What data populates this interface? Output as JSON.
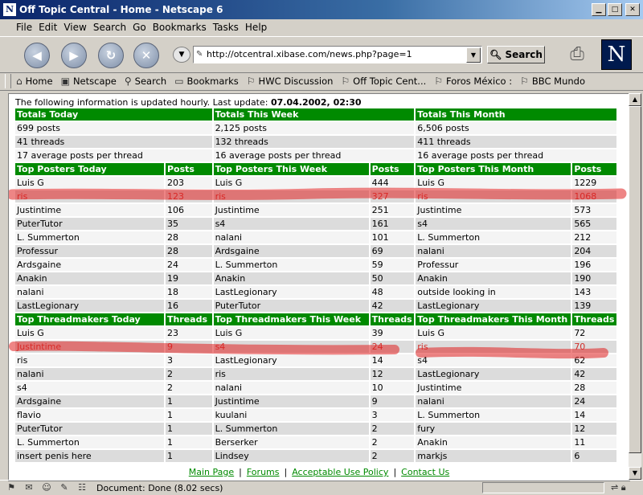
{
  "window": {
    "title": "Off Topic Central - Home - Netscape 6",
    "app_icon": "N"
  },
  "menu": [
    "File",
    "Edit",
    "View",
    "Search",
    "Go",
    "Bookmarks",
    "Tasks",
    "Help"
  ],
  "navigation": {
    "url": "http://otcentral.xibase.com/news.php?page=1",
    "search_label": "Search",
    "logo_letter": "N"
  },
  "personal_toolbar": [
    "Home",
    "Netscape",
    "Search",
    "Bookmarks",
    "HWC Discussion",
    "Off Topic Cent...",
    "Foros México :",
    "BBC Mundo"
  ],
  "update_info": {
    "text": "The following information is updated hourly. Last update: ",
    "date": "07.04.2002, 02:30"
  },
  "totals": {
    "headers": [
      "Totals Today",
      "Totals This Week",
      "Totals This Month"
    ],
    "rows": [
      [
        "699 posts",
        "2,125 posts",
        "6,506 posts"
      ],
      [
        "41 threads",
        "132 threads",
        "411 threads"
      ],
      [
        "17 average posts per thread",
        "16 average posts per thread",
        "16 average posts per thread"
      ]
    ]
  },
  "top_posters": {
    "headers": [
      "Top Posters Today",
      "Posts",
      "Top Posters This Week",
      "Posts",
      "Top Posters This Month",
      "Posts"
    ],
    "rows": [
      [
        "Luis G",
        "203",
        "Luis G",
        "444",
        "Luis G",
        "1229"
      ],
      [
        "ris",
        "123",
        "ris",
        "327",
        "ris",
        "1068"
      ],
      [
        "Justintime",
        "106",
        "Justintime",
        "251",
        "Justintime",
        "573"
      ],
      [
        "PuterTutor",
        "35",
        "s4",
        "161",
        "s4",
        "565"
      ],
      [
        "L. Summerton",
        "28",
        "nalani",
        "101",
        "L. Summerton",
        "212"
      ],
      [
        "Professur",
        "28",
        "Ardsgaine",
        "69",
        "nalani",
        "204"
      ],
      [
        "Ardsgaine",
        "24",
        "L. Summerton",
        "59",
        "Professur",
        "196"
      ],
      [
        "Anakin",
        "19",
        "Anakin",
        "50",
        "Anakin",
        "190"
      ],
      [
        "nalani",
        "18",
        "LastLegionary",
        "48",
        "outside looking in",
        "143"
      ],
      [
        "LastLegionary",
        "16",
        "PuterTutor",
        "42",
        "LastLegionary",
        "139"
      ]
    ]
  },
  "top_threadmakers": {
    "headers": [
      "Top Threadmakers Today",
      "Threads",
      "Top Threadmakers This Week",
      "Threads",
      "Top Threadmakers This Month",
      "Threads"
    ],
    "rows": [
      [
        "Luis G",
        "23",
        "Luis G",
        "39",
        "Luis G",
        "72"
      ],
      [
        "Justintime",
        "9",
        "s4",
        "24",
        "ris",
        "70"
      ],
      [
        "ris",
        "3",
        "LastLegionary",
        "14",
        "s4",
        "62"
      ],
      [
        "nalani",
        "2",
        "ris",
        "12",
        "LastLegionary",
        "42"
      ],
      [
        "s4",
        "2",
        "nalani",
        "10",
        "Justintime",
        "28"
      ],
      [
        "Ardsgaine",
        "1",
        "Justintime",
        "9",
        "nalani",
        "24"
      ],
      [
        "flavio",
        "1",
        "kuulani",
        "3",
        "L. Summerton",
        "14"
      ],
      [
        "PuterTutor",
        "1",
        "L. Summerton",
        "2",
        "fury",
        "12"
      ],
      [
        "L. Summerton",
        "1",
        "Berserker",
        "2",
        "Anakin",
        "11"
      ],
      [
        "insert penis here",
        "1",
        "Lindsey",
        "2",
        "markjs",
        "6"
      ]
    ]
  },
  "footer_links": [
    "Main Page",
    "Forums",
    "Acceptable Use Policy",
    "Contact Us"
  ],
  "status": {
    "text": "Document: Done (8.02 secs)"
  },
  "colors": {
    "header_green": "#008a00",
    "title_blue": "#0a246a",
    "redaction_red": "#e02020"
  }
}
